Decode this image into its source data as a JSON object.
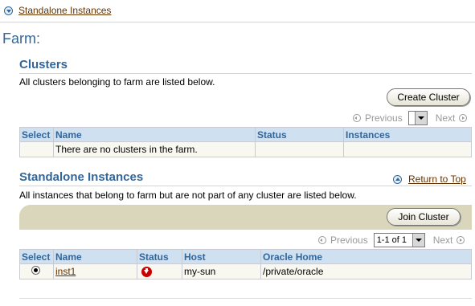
{
  "top_link": {
    "label": "Standalone Instances",
    "icon": "chevron-down-circle-icon"
  },
  "page_title": "Farm:",
  "clusters": {
    "title": "Clusters",
    "description": "All clusters belonging to farm are listed below.",
    "create_button": "Create Cluster",
    "pager": {
      "previous": "Previous",
      "next": "Next",
      "select_value": ""
    },
    "columns": [
      "Select",
      "Name",
      "Status",
      "Instances"
    ],
    "empty_message": "There are no clusters in the farm."
  },
  "standalone": {
    "title": "Standalone Instances",
    "return_to_top": "Return to Top",
    "description": "All instances that belong to farm but are not part of any cluster are listed below.",
    "join_button": "Join Cluster",
    "pager": {
      "previous": "Previous",
      "next": "Next",
      "select_value": "1-1 of 1"
    },
    "columns": [
      "Select",
      "Name",
      "Status",
      "Host",
      "Oracle Home"
    ],
    "rows": [
      {
        "selected": true,
        "name": "inst1",
        "status": "down",
        "host": "my-sun",
        "oracle_home": "/private/oracle"
      }
    ]
  },
  "colors": {
    "accent": "#336699",
    "link": "#663300",
    "header_bg": "#cfe0f1",
    "band": "#d9d6bb",
    "status_down": "#cc0000"
  }
}
